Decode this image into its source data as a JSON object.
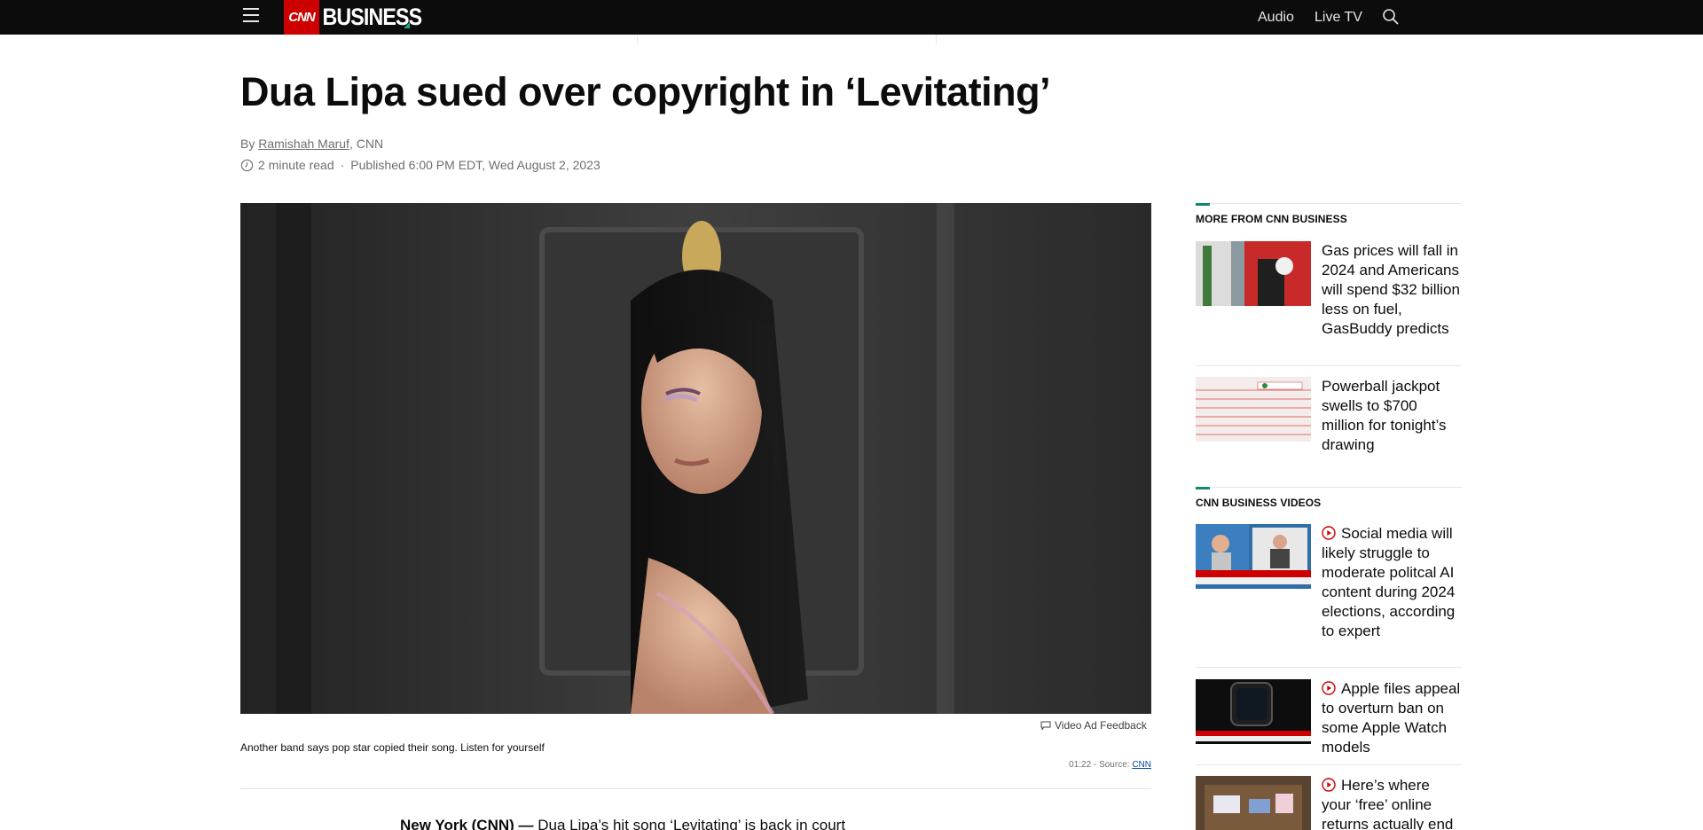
{
  "header": {
    "nav_audio": "Audio",
    "nav_live_tv": "Live TV",
    "logo_cnn": "CNN",
    "logo_business": "BUSINESS"
  },
  "article": {
    "headline": "Dua Lipa sued over copyright in ‘Levitating’",
    "by_prefix": "By ",
    "author": "Ramishah Maruf",
    "outlet": ", CNN",
    "read_time": "2 minute read",
    "separator": "·",
    "published": "Published 6:00 PM EDT, Wed August 2, 2023",
    "body_lead_bold": "New York (CNN) —",
    "body_lead_text": " Dua Lipa’s hit song ‘Levitating’ is back in court"
  },
  "video": {
    "feedback": "Video Ad Feedback",
    "caption": "Another band says pop star copied their song. Listen for yourself",
    "duration": "01:22",
    "source_prefix": " - Source: ",
    "source": "CNN"
  },
  "sidebar": {
    "more_title": "MORE FROM CNN BUSINESS",
    "more_items": [
      {
        "title": "Gas prices will fall in 2024 and Americans will spend $32 billion less on fuel, GasBuddy predicts"
      },
      {
        "title": "Powerball jackpot swells to $700 million for tonight’s drawing"
      }
    ],
    "videos_title": "CNN BUSINESS VIDEOS",
    "video_items": [
      {
        "title": "Social media will likely struggle to moderate politcal AI content during 2024 elections, according to expert"
      },
      {
        "title": "Apple files appeal to overturn ban on some Apple Watch models"
      },
      {
        "title": "Here’s where your ‘free’ online returns actually end"
      }
    ]
  },
  "icons": {
    "menu": "hamburger-menu-icon",
    "search": "search-icon",
    "clock": "clock-icon",
    "feedback": "comment-icon",
    "play": "play-circle-icon"
  },
  "colors": {
    "header_bg": "#0c0c0c",
    "cnn_red": "#cc0000",
    "accent_green": "#12886c",
    "play_red": "#cc0000"
  }
}
